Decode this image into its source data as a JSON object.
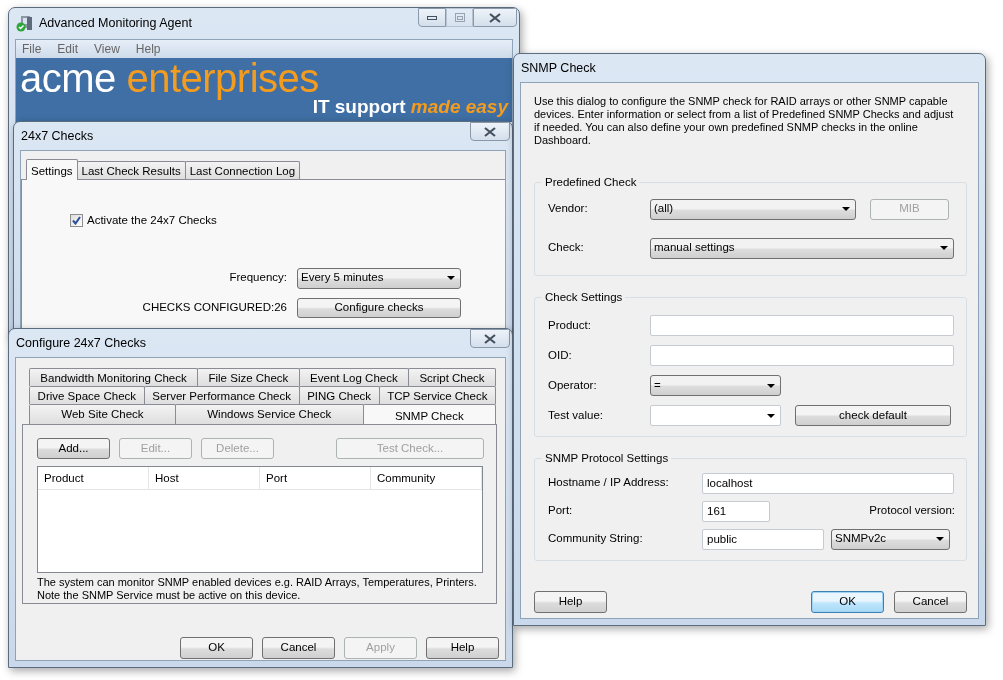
{
  "main_window": {
    "title": "Advanced Monitoring Agent",
    "window_buttons": [
      {
        "kind": "minimize",
        "disabled": false
      },
      {
        "kind": "maximize",
        "disabled": true
      },
      {
        "kind": "close",
        "disabled": false
      }
    ],
    "menu": [
      "File",
      "Edit",
      "View",
      "Help"
    ],
    "banner": {
      "brand_first": "acme",
      "brand_second": "enterprises",
      "tagline_first": "IT support",
      "tagline_second": "made easy"
    }
  },
  "checks_window": {
    "title": "24x7 Checks",
    "tabs": [
      {
        "label": "Settings",
        "selected": true
      },
      {
        "label": "Last Check Results",
        "selected": false
      },
      {
        "label": "Last Connection Log",
        "selected": false
      }
    ],
    "activate": {
      "label": "Activate the 24x7 Checks",
      "checked": true
    },
    "frequency": {
      "label": "Frequency:",
      "value": "Every 5 minutes"
    },
    "configured": {
      "label": "CHECKS CONFIGURED:26",
      "button": "Configure checks"
    }
  },
  "configure_window": {
    "title": "Configure 24x7 Checks",
    "tab_rows": [
      [
        {
          "label": "Bandwidth Monitoring Check",
          "selected": false
        },
        {
          "label": "File Size Check",
          "selected": false
        },
        {
          "label": "Event Log Check",
          "selected": false
        },
        {
          "label": "Script Check",
          "selected": false
        }
      ],
      [
        {
          "label": "Drive Space Check",
          "selected": false
        },
        {
          "label": "Server Performance Check",
          "selected": false
        },
        {
          "label": "PING Check",
          "selected": false
        },
        {
          "label": "TCP Service Check",
          "selected": false
        }
      ],
      [
        {
          "label": "Web Site Check",
          "selected": false
        },
        {
          "label": "Windows Service Check",
          "selected": false
        },
        {
          "label": "SNMP Check",
          "selected": true
        }
      ]
    ],
    "actions": [
      {
        "label": "Add...",
        "disabled": false
      },
      {
        "label": "Edit...",
        "disabled": true
      },
      {
        "label": "Delete...",
        "disabled": true
      }
    ],
    "test_button": {
      "label": "Test Check...",
      "disabled": true
    },
    "columns": [
      "Product",
      "Host",
      "Port",
      "Community"
    ],
    "note": "The system can monitor SNMP enabled devices e.g. RAID Arrays, Temperatures, Printers. Note the SNMP Service must be active on this device.",
    "footer_buttons": [
      {
        "label": "OK",
        "disabled": false
      },
      {
        "label": "Cancel",
        "disabled": false
      },
      {
        "label": "Apply",
        "disabled": true
      },
      {
        "label": "Help",
        "disabled": false
      }
    ]
  },
  "snmp_window": {
    "title": "SNMP Check",
    "intro": "Use this dialog to configure the SNMP check for RAID arrays or other SNMP capable devices. Enter information or select from a list of Predefined SNMP Checks and adjust if needed. You can also define your own predefined SNMP checks in the online Dashboard.",
    "predefined": {
      "title": "Predefined Check",
      "vendor_label": "Vendor:",
      "vendor_value": "(all)",
      "mib_button": {
        "label": "MIB",
        "disabled": true
      },
      "check_label": "Check:",
      "check_value": "manual settings"
    },
    "check_settings": {
      "title": "Check Settings",
      "product_label": "Product:",
      "oid_label": "OID:",
      "operator_label": "Operator:",
      "operator_value": "=",
      "test_value_label": "Test value:",
      "check_default_button": "check default"
    },
    "protocol": {
      "title": "SNMP Protocol Settings",
      "hostname_label": "Hostname / IP Address:",
      "hostname_value": "localhost",
      "port_label": "Port:",
      "port_value": "161",
      "version_label": "Protocol version:",
      "community_label": "Community String:",
      "community_value": "public",
      "version_value": "SNMPv2c"
    },
    "footer_buttons": [
      {
        "label": "Help",
        "default": false
      },
      {
        "label": "OK",
        "default": true
      },
      {
        "label": "Cancel",
        "default": false
      }
    ]
  }
}
